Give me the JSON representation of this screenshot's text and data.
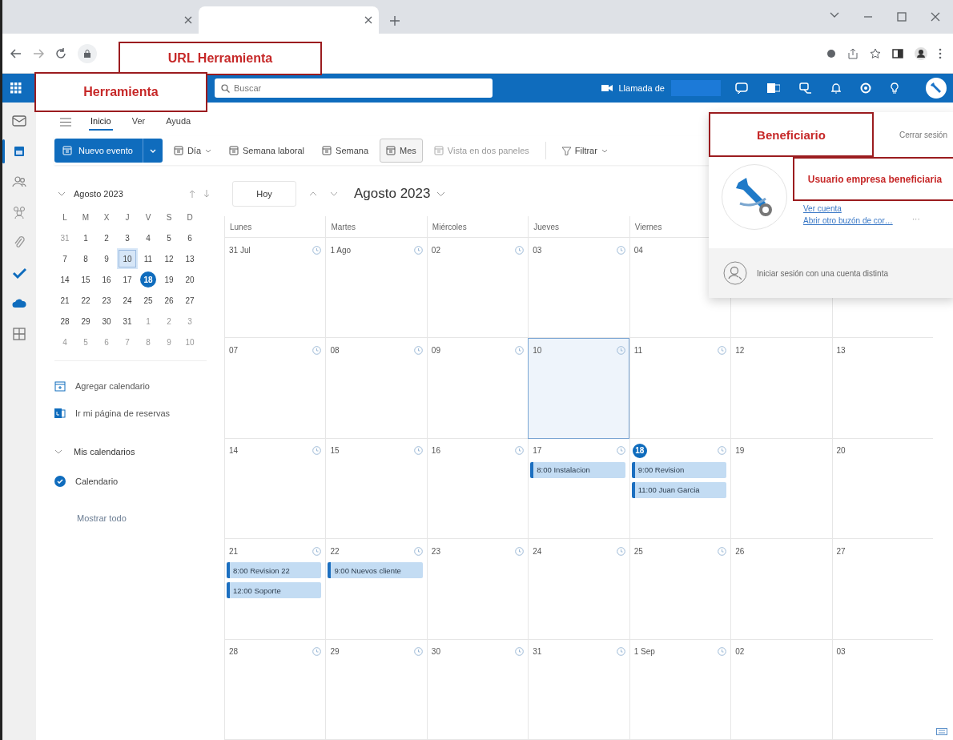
{
  "browser": {
    "tabs": [
      {
        "selected": false
      },
      {
        "selected": true
      }
    ]
  },
  "address_bar": {
    "annotation": "URL Herramienta"
  },
  "header": {
    "annotation": "Herramienta",
    "search_placeholder": "Buscar",
    "call_label": "Llamada de"
  },
  "left_rail": [
    {
      "kind": "mail",
      "selected": false
    },
    {
      "kind": "calendar",
      "selected": true
    },
    {
      "kind": "people",
      "selected": false
    },
    {
      "kind": "groups",
      "selected": false
    },
    {
      "kind": "files",
      "selected": false
    },
    {
      "kind": "todo",
      "selected": false
    },
    {
      "kind": "cloud",
      "selected": false
    },
    {
      "kind": "apps",
      "selected": false
    }
  ],
  "ribbon": {
    "tabs": [
      {
        "label": "Inicio",
        "selected": true
      },
      {
        "label": "Ver",
        "selected": false
      },
      {
        "label": "Ayuda",
        "selected": false
      }
    ],
    "new_event": "Nuevo evento",
    "views": [
      {
        "label": "Día",
        "has_menu": true,
        "selected": false,
        "disabled": false
      },
      {
        "label": "Semana laboral",
        "has_menu": false,
        "selected": false,
        "disabled": false
      },
      {
        "label": "Semana",
        "has_menu": false,
        "selected": false,
        "disabled": false
      },
      {
        "label": "Mes",
        "has_menu": false,
        "selected": true,
        "disabled": false
      },
      {
        "label": "Vista en dos paneles",
        "has_menu": false,
        "selected": false,
        "disabled": true
      }
    ],
    "filter": "Filtrar"
  },
  "mini_calendar": {
    "title": "Agosto 2023",
    "weekdays": [
      "L",
      "M",
      "X",
      "J",
      "V",
      "S",
      "D"
    ],
    "weeks": [
      [
        {
          "day": "31",
          "in_month": false,
          "selected": false,
          "today": false
        },
        {
          "day": "1",
          "in_month": true,
          "selected": false,
          "today": false
        },
        {
          "day": "2",
          "in_month": true,
          "selected": false,
          "today": false
        },
        {
          "day": "3",
          "in_month": true,
          "selected": false,
          "today": false
        },
        {
          "day": "4",
          "in_month": true,
          "selected": false,
          "today": false
        },
        {
          "day": "5",
          "in_month": true,
          "selected": false,
          "today": false
        },
        {
          "day": "6",
          "in_month": true,
          "selected": false,
          "today": false
        }
      ],
      [
        {
          "day": "7",
          "in_month": true,
          "selected": false,
          "today": false
        },
        {
          "day": "8",
          "in_month": true,
          "selected": false,
          "today": false
        },
        {
          "day": "9",
          "in_month": true,
          "selected": false,
          "today": false
        },
        {
          "day": "10",
          "in_month": true,
          "selected": true,
          "today": false
        },
        {
          "day": "11",
          "in_month": true,
          "selected": false,
          "today": false
        },
        {
          "day": "12",
          "in_month": true,
          "selected": false,
          "today": false
        },
        {
          "day": "13",
          "in_month": true,
          "selected": false,
          "today": false
        }
      ],
      [
        {
          "day": "14",
          "in_month": true,
          "selected": false,
          "today": false
        },
        {
          "day": "15",
          "in_month": true,
          "selected": false,
          "today": false
        },
        {
          "day": "16",
          "in_month": true,
          "selected": false,
          "today": false
        },
        {
          "day": "17",
          "in_month": true,
          "selected": false,
          "today": false
        },
        {
          "day": "18",
          "in_month": true,
          "selected": false,
          "today": true
        },
        {
          "day": "19",
          "in_month": true,
          "selected": false,
          "today": false
        },
        {
          "day": "20",
          "in_month": true,
          "selected": false,
          "today": false
        }
      ],
      [
        {
          "day": "21",
          "in_month": true,
          "selected": false,
          "today": false
        },
        {
          "day": "22",
          "in_month": true,
          "selected": false,
          "today": false
        },
        {
          "day": "23",
          "in_month": true,
          "selected": false,
          "today": false
        },
        {
          "day": "24",
          "in_month": true,
          "selected": false,
          "today": false
        },
        {
          "day": "25",
          "in_month": true,
          "selected": false,
          "today": false
        },
        {
          "day": "26",
          "in_month": true,
          "selected": false,
          "today": false
        },
        {
          "day": "27",
          "in_month": true,
          "selected": false,
          "today": false
        }
      ],
      [
        {
          "day": "28",
          "in_month": true,
          "selected": false,
          "today": false
        },
        {
          "day": "29",
          "in_month": true,
          "selected": false,
          "today": false
        },
        {
          "day": "30",
          "in_month": true,
          "selected": false,
          "today": false
        },
        {
          "day": "31",
          "in_month": true,
          "selected": false,
          "today": false
        },
        {
          "day": "1",
          "in_month": false,
          "selected": false,
          "today": false
        },
        {
          "day": "2",
          "in_month": false,
          "selected": false,
          "today": false
        },
        {
          "day": "3",
          "in_month": false,
          "selected": false,
          "today": false
        }
      ],
      [
        {
          "day": "4",
          "in_month": false,
          "selected": false,
          "today": false
        },
        {
          "day": "5",
          "in_month": false,
          "selected": false,
          "today": false
        },
        {
          "day": "6",
          "in_month": false,
          "selected": false,
          "today": false
        },
        {
          "day": "7",
          "in_month": false,
          "selected": false,
          "today": false
        },
        {
          "day": "8",
          "in_month": false,
          "selected": false,
          "today": false
        },
        {
          "day": "9",
          "in_month": false,
          "selected": false,
          "today": false
        },
        {
          "day": "10",
          "in_month": false,
          "selected": false,
          "today": false
        }
      ]
    ]
  },
  "side_links": [
    {
      "kind": "add",
      "label": "Agregar calendario"
    },
    {
      "kind": "bookings",
      "label": "Ir mi página de reservas"
    }
  ],
  "my_calendars": {
    "title": "Mis calendarios",
    "expanded": true,
    "calendars": [
      {
        "name": "Calendario",
        "checked": true,
        "color": "#0f6cbd"
      }
    ],
    "show_all": "Mostrar todo"
  },
  "calendar": {
    "today_button": "Hoy",
    "title": "Agosto 2023",
    "columns": [
      "Lunes",
      "Martes",
      "Miércoles",
      "Jueves",
      "Viernes"
    ],
    "weeks": [
      [
        {
          "date": "31 Jul",
          "kind": "weekday",
          "selected": false
        },
        {
          "date": "1 Ago",
          "kind": "weekday",
          "selected": false
        },
        {
          "date": "02",
          "kind": "weekday",
          "selected": false
        },
        {
          "date": "03",
          "kind": "weekday",
          "selected": false
        },
        {
          "date": "04",
          "kind": "weekday",
          "selected": false
        },
        {
          "kind": "weekend",
          "selected": false
        },
        {
          "kind": "weekend",
          "selected": false
        }
      ],
      [
        {
          "date": "07",
          "kind": "weekday",
          "selected": false
        },
        {
          "date": "08",
          "kind": "weekday",
          "selected": false
        },
        {
          "date": "09",
          "kind": "weekday",
          "selected": false
        },
        {
          "date": "10",
          "kind": "weekday",
          "selected": true
        },
        {
          "date": "11",
          "kind": "weekday",
          "selected": false
        },
        {
          "date": "12",
          "kind": "weekend",
          "selected": false
        },
        {
          "date": "13",
          "kind": "weekend",
          "selected": false
        }
      ],
      [
        {
          "date": "14",
          "kind": "weekday",
          "selected": false
        },
        {
          "date": "15",
          "kind": "weekday",
          "selected": false
        },
        {
          "date": "16",
          "kind": "weekday",
          "selected": false
        },
        {
          "date": "17",
          "kind": "weekday",
          "selected": false,
          "events": [
            "8:00 Instalacion"
          ]
        },
        {
          "date": "18",
          "kind": "weekday",
          "selected": false,
          "today": true,
          "events": [
            "9:00 Revision",
            "11:00 Juan Garcia"
          ]
        },
        {
          "date": "19",
          "kind": "weekend",
          "selected": false
        },
        {
          "date": "20",
          "kind": "weekend",
          "selected": false
        }
      ],
      [
        {
          "date": "21",
          "kind": "weekday",
          "selected": false,
          "events": [
            "8:00 Revision 22",
            "12:00 Soporte"
          ]
        },
        {
          "date": "22",
          "kind": "weekday",
          "selected": false,
          "events": [
            "9:00 Nuevos cliente"
          ]
        },
        {
          "date": "23",
          "kind": "weekday",
          "selected": false
        },
        {
          "date": "24",
          "kind": "weekday",
          "selected": false
        },
        {
          "date": "25",
          "kind": "weekday",
          "selected": false
        },
        {
          "date": "26",
          "kind": "weekend",
          "selected": false
        },
        {
          "date": "27",
          "kind": "weekend",
          "selected": false
        }
      ],
      [
        {
          "date": "28",
          "kind": "weekday",
          "selected": false
        },
        {
          "date": "29",
          "kind": "weekday",
          "selected": false
        },
        {
          "date": "30",
          "kind": "weekday",
          "selected": false
        },
        {
          "date": "31",
          "kind": "weekday",
          "selected": false
        },
        {
          "date": "1 Sep",
          "kind": "weekday",
          "selected": false
        },
        {
          "date": "02",
          "kind": "weekend",
          "selected": false
        },
        {
          "date": "03",
          "kind": "weekend",
          "selected": false
        }
      ]
    ]
  },
  "account_popup": {
    "annotation": "Beneficiario",
    "sign_out": "Cerrar sesión",
    "user_annotation": "Usuario empresa beneficiaria",
    "links": [
      "Ver cuenta",
      "Abrir otro buzón de cor…"
    ],
    "more": "···",
    "other_account": "Iniciar sesión con una cuenta distinta"
  }
}
